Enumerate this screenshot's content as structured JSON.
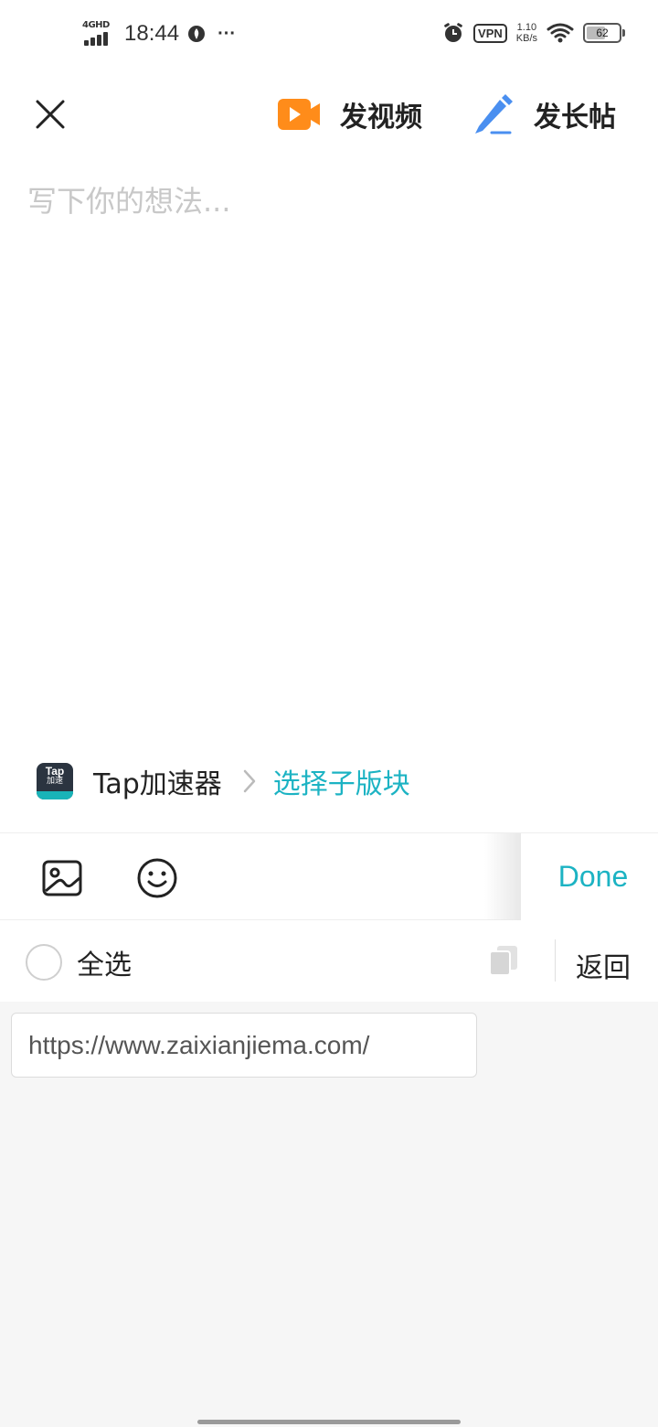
{
  "status_bar": {
    "network": "4GHD",
    "time": "18:44",
    "more": "···",
    "vpn": "VPN",
    "speed_value": "1.10",
    "speed_unit": "KB/s",
    "battery_level": 62,
    "battery_text": "62"
  },
  "topbar": {
    "video_label": "发视频",
    "long_post_label": "发长帖",
    "video_icon_color": "#ff8c1a",
    "pen_icon_color": "#4a8ff0"
  },
  "compose": {
    "placeholder": "写下你的想法...",
    "value": ""
  },
  "forum": {
    "logo_line1": "Tap",
    "logo_line2": "加速",
    "name": "Tap加速器",
    "subforum_label": "选择子版块",
    "accent": "#1cb3c3"
  },
  "toolbar": {
    "done_label": "Done"
  },
  "clipboard": {
    "select_all_label": "全选",
    "back_label": "返回",
    "items": [
      {
        "text": "https://www.zaixianjiema.com/"
      }
    ]
  }
}
